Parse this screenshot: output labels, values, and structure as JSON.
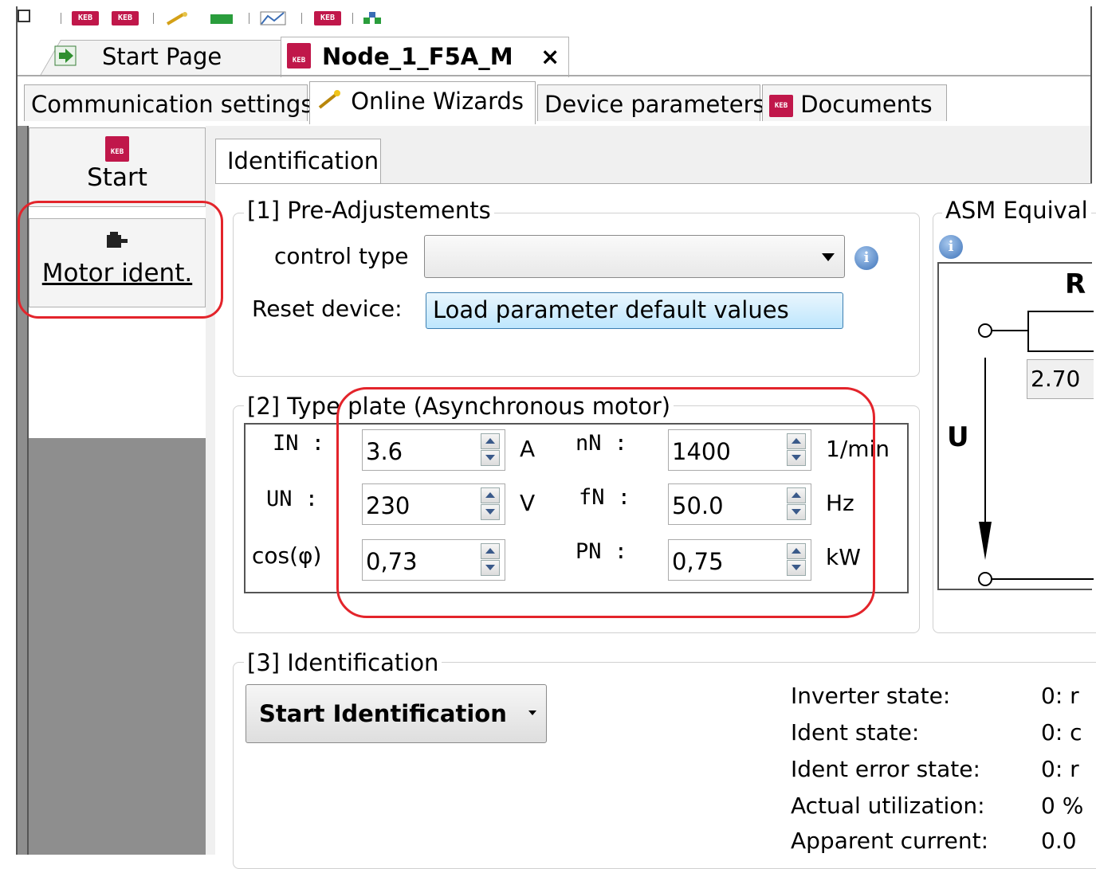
{
  "toolbar": {
    "icons": [
      "checkbox-icon",
      "keb-icon",
      "keb-icon",
      "wand-icon",
      "monitor-icon",
      "chart-icon",
      "keb-icon",
      "network-icon"
    ]
  },
  "doc_tabs": {
    "start": "Start Page",
    "node": "Node_1_F5A_M",
    "close": "×"
  },
  "tabs": [
    "Communication settings",
    "Online Wizards",
    "Device parameters",
    "Documents"
  ],
  "nav": {
    "start": "Start",
    "motor": "Motor ident."
  },
  "ident_tab": "Identification",
  "pre": {
    "legend": "[1] Pre-Adjustements",
    "control_type_label": "control type",
    "control_type_value": "",
    "reset_label": "Reset device:",
    "reset_button": "Load parameter default values"
  },
  "plate": {
    "legend": "[2] Type plate (Asynchronous motor)",
    "in_label": "IN :",
    "in_value": "3.6",
    "in_unit": "A",
    "nn_label": "nN :",
    "nn_value": "1400",
    "nn_unit": "1/min",
    "un_label": "UN :",
    "un_value": "230",
    "un_unit": "V",
    "fn_label": "fN :",
    "fn_value": "50.0",
    "fn_unit": "Hz",
    "cos_label": "cos(φ)",
    "cos_value": "0,73",
    "pn_label": "PN :",
    "pn_value": "0,75",
    "pn_unit": "kW"
  },
  "asm": {
    "legend": "ASM Equival",
    "r_label": "R",
    "r_value": "2.70",
    "u_label": "U"
  },
  "ident": {
    "legend": "[3] Identification",
    "start_button": "Start Identification",
    "status": [
      {
        "label": "Inverter state:",
        "value": "0: r"
      },
      {
        "label": "Ident state:",
        "value": "0: c"
      },
      {
        "label": "Ident error state:",
        "value": "0: r"
      },
      {
        "label": "Actual utilization:",
        "value": "0 %"
      },
      {
        "label": "Apparent current:",
        "value": "0.0"
      }
    ]
  },
  "colors": {
    "highlight": "#e3242b",
    "keb": "#c0174a",
    "accent_blue": "#3c7fb1"
  }
}
